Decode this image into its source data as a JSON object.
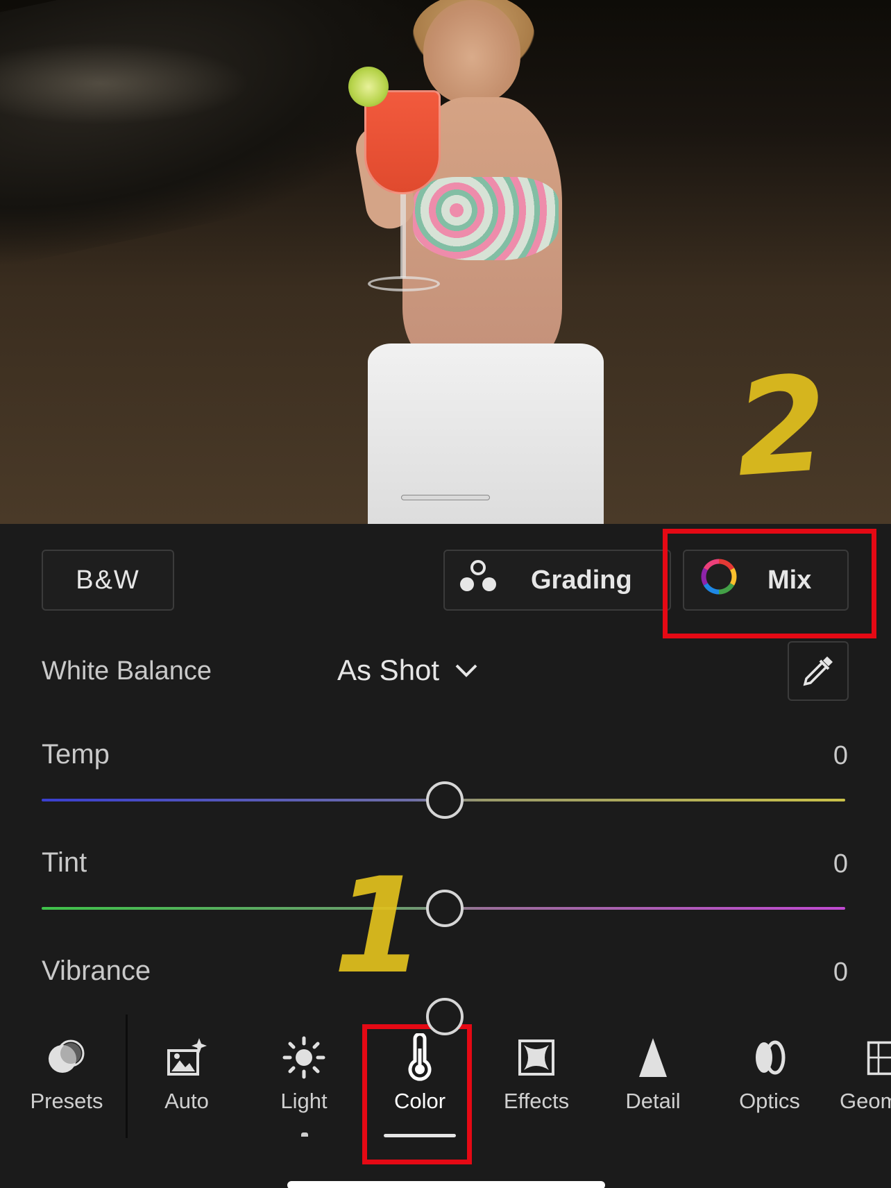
{
  "annotations": {
    "step_one": "1",
    "step_two": "2"
  },
  "colors": {
    "highlight": "#e50914",
    "annotation": "#e2c11e",
    "background": "#1b1b1b"
  },
  "profile_buttons": {
    "bw": "B&W",
    "grading": "Grading",
    "mix": "Mix"
  },
  "white_balance": {
    "label": "White Balance",
    "value": "As Shot"
  },
  "sliders": [
    {
      "label": "Temp",
      "value": "0"
    },
    {
      "label": "Tint",
      "value": "0"
    },
    {
      "label": "Vibrance",
      "value": "0"
    }
  ],
  "toolbar": {
    "items": [
      {
        "label": "Presets",
        "icon": "presets-icon"
      },
      {
        "label": "Auto",
        "icon": "auto-icon"
      },
      {
        "label": "Light",
        "icon": "sun-icon"
      },
      {
        "label": "Color",
        "icon": "thermometer-icon",
        "active": true
      },
      {
        "label": "Effects",
        "icon": "effects-icon"
      },
      {
        "label": "Detail",
        "icon": "triangle-icon"
      },
      {
        "label": "Optics",
        "icon": "lens-icon"
      },
      {
        "label": "Geom",
        "icon": "geometry-icon"
      }
    ]
  }
}
